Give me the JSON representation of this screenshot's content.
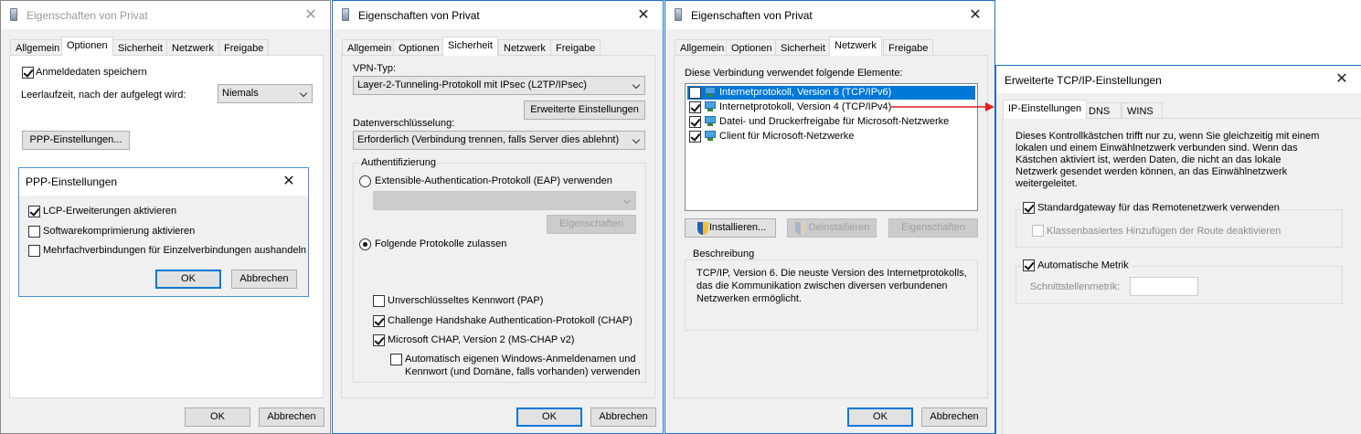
{
  "dialog1": {
    "title": "Eigenschaften von Privat",
    "tabs": [
      "Allgemein",
      "Optionen",
      "Sicherheit",
      "Netzwerk",
      "Freigabe"
    ],
    "save_credentials_label": "Anmeldedaten speichern",
    "save_credentials_checked": true,
    "idle_label": "Leerlaufzeit, nach der aufgelegt wird:",
    "idle_value": "Niemals",
    "ppp_button": "PPP-Einstellungen...",
    "ok": "OK",
    "cancel": "Abbrechen"
  },
  "ppp": {
    "title": "PPP-Einstellungen",
    "options": [
      {
        "label": "LCP-Erweiterungen aktivieren",
        "checked": true
      },
      {
        "label": "Softwarekomprimierung aktivieren",
        "checked": false
      },
      {
        "label": "Mehrfachverbindungen für Einzelverbindungen aushandeln",
        "checked": false
      }
    ],
    "ok": "OK",
    "cancel": "Abbrechen"
  },
  "dialog2": {
    "title": "Eigenschaften von Privat",
    "tabs": [
      "Allgemein",
      "Optionen",
      "Sicherheit",
      "Netzwerk",
      "Freigabe"
    ],
    "vpn_type_label": "VPN-Typ:",
    "vpn_type_value": "Layer-2-Tunneling-Protokoll mit IPsec (L2TP/IPsec)",
    "advanced_button": "Erweiterte Einstellungen",
    "encryption_label": "Datenverschlüsselung:",
    "encryption_value": "Erforderlich (Verbindung trennen, falls Server dies ablehnt)",
    "auth_group": "Authentifizierung",
    "eap_label": "Extensible-Authentication-Protokoll (EAP) verwenden",
    "eap_value": "",
    "eap_props_button": "Eigenschaften",
    "protocols_label": "Folgende Protokolle zulassen",
    "pap_label": "Unverschlüsseltes Kennwort (PAP)",
    "chap_label": "Challenge Handshake Authentication-Protokoll (CHAP)",
    "mschap_label": "Microsoft CHAP, Version 2 (MS-CHAP v2)",
    "autologon_line1": "Automatisch eigenen Windows-Anmeldenamen und",
    "autologon_line2": "Kennwort (und Domäne, falls vorhanden) verwenden",
    "ok": "OK",
    "cancel": "Abbrechen"
  },
  "dialog3": {
    "title": "Eigenschaften von Privat",
    "tabs": [
      "Allgemein",
      "Optionen",
      "Sicherheit",
      "Netzwerk",
      "Freigabe"
    ],
    "elements_label": "Diese Verbindung verwendet folgende Elemente:",
    "items": [
      {
        "label": "Internetprotokoll, Version 6 (TCP/IPv6)",
        "checked": false,
        "selected": true
      },
      {
        "label": "Internetprotokoll, Version 4 (TCP/IPv4)",
        "checked": true,
        "selected": false
      },
      {
        "label": "Datei- und Druckerfreigabe für Microsoft-Netzwerke",
        "checked": true,
        "selected": false
      },
      {
        "label": "Client für Microsoft-Netzwerke",
        "checked": true,
        "selected": false
      }
    ],
    "install_button": "Installieren...",
    "uninstall_button": "Deinstallieren",
    "props_button": "Eigenschaften",
    "description_group": "Beschreibung",
    "description_text_1": "TCP/IP, Version 6. Die neuste Version des Internetprotokolls,",
    "description_text_2": "das die Kommunikation zwischen diversen verbundenen",
    "description_text_3": "Netzwerken ermöglicht.",
    "ok": "OK",
    "cancel": "Abbrechen"
  },
  "dialog4": {
    "title": "Erweiterte TCP/IP-Einstellungen",
    "tabs": [
      "IP-Einstellungen",
      "DNS",
      "WINS"
    ],
    "info_1": "Dieses Kontrollkästchen trifft nur zu, wenn Sie gleichzeitig mit einem",
    "info_2": "lokalen und einem Einwählnetzwerk verbunden sind. Wenn das",
    "info_3": "Kästchen aktiviert ist, werden Daten, die nicht an das lokale",
    "info_4": "Netzwerk gesendet werden können, an das Einwählnetzwerk",
    "info_5": "weitergeleitet.",
    "gateway_label": "Standardgateway für das Remotenetzwerk verwenden",
    "classbased_label": "Klassenbasiertes Hinzufügen der Route deaktivieren",
    "metric_label": "Automatische Metrik",
    "interface_metric_label": "Schnittstellenmetrik:",
    "interface_metric_value": ""
  },
  "colors": {
    "accent": "#0078d7",
    "selection": "#0078d7",
    "arrow": "#e02020"
  }
}
